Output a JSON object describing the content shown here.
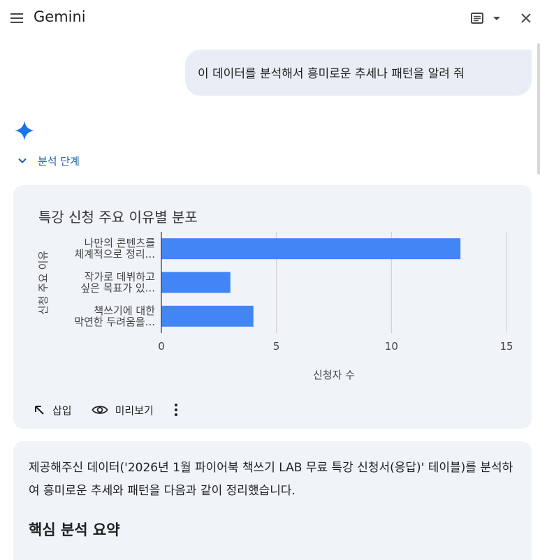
{
  "header": {
    "title": "Gemini"
  },
  "conversation": {
    "user_message": "이 데이터를 분석해서 흥미로운 추세나 패턴을 알려 줘",
    "steps_label": "분석 단계"
  },
  "chart_data": {
    "type": "bar",
    "orientation": "horizontal",
    "title": "특강 신청 주요 이유별 분포",
    "ylabel": "신청 주요 이유",
    "xlabel": "신청자 수",
    "categories": [
      [
        "나만의 콘텐츠를",
        "체계적으로 정리..."
      ],
      [
        "작가로 데뷔하고",
        "싶은 목표가 있..."
      ],
      [
        "책쓰기에 대한",
        "막연한 두려움을..."
      ]
    ],
    "values": [
      13,
      3,
      4
    ],
    "xlim": [
      0,
      15
    ],
    "xticks": [
      "0",
      "5",
      "10",
      "15"
    ],
    "grid": true,
    "bar_color": "#4285f4"
  },
  "chart_actions": {
    "insert_label": "삽입",
    "preview_label": "미리보기"
  },
  "response": {
    "paragraph": "제공해주신 데이터('2026년 1월 파이어북 책쓰기 LAB 무료 특강 신청서(응답)' 테이블)를 분석하여 흥미로운 추세와 패턴을 다음과 같이 정리했습니다.",
    "heading": "핵심 분석 요약"
  },
  "colors": {
    "accent": "#1b5fa8",
    "card_bg": "#f0f4f9",
    "user_bubble": "#e9eef6",
    "spark_blue": "#1a73e8"
  }
}
